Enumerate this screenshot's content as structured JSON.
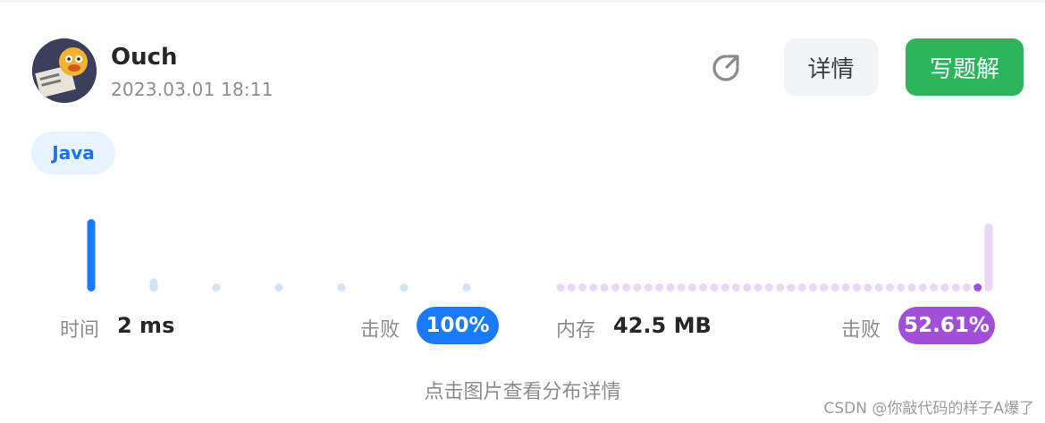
{
  "submission": {
    "username": "Ouch",
    "timestamp": "2023.03.01 18:11"
  },
  "actions": {
    "details_label": "详情",
    "write_solution_label": "写题解",
    "share_icon": "share-external-icon"
  },
  "language_tag": "Java",
  "stats": {
    "runtime_label": "时间",
    "runtime_value": "2 ms",
    "runtime_beat_label": "击败",
    "runtime_beat_value": "100%",
    "memory_label": "内存",
    "memory_value": "42.5 MB",
    "memory_beat_label": "击败",
    "memory_beat_value": "52.61%"
  },
  "hint": "点击图片查看分布详情",
  "watermark": "CSDN @你敲代码的样子A爆了",
  "colors": {
    "accent_green": "#2db55d",
    "accent_blue": "#1a7afc",
    "accent_purple": "#a24fd8",
    "tag_bg": "#e8f3ff"
  },
  "chart_data": [
    {
      "type": "bar",
      "name": "runtime",
      "values": [
        1.0,
        0.18,
        0.05,
        0.05,
        0.05,
        0.05,
        0.05
      ],
      "highlight_index": 0
    },
    {
      "type": "bar",
      "name": "memory",
      "count": 40,
      "highlight_index": 39,
      "highlight_value": 1.0,
      "marker_index": 38
    }
  ]
}
